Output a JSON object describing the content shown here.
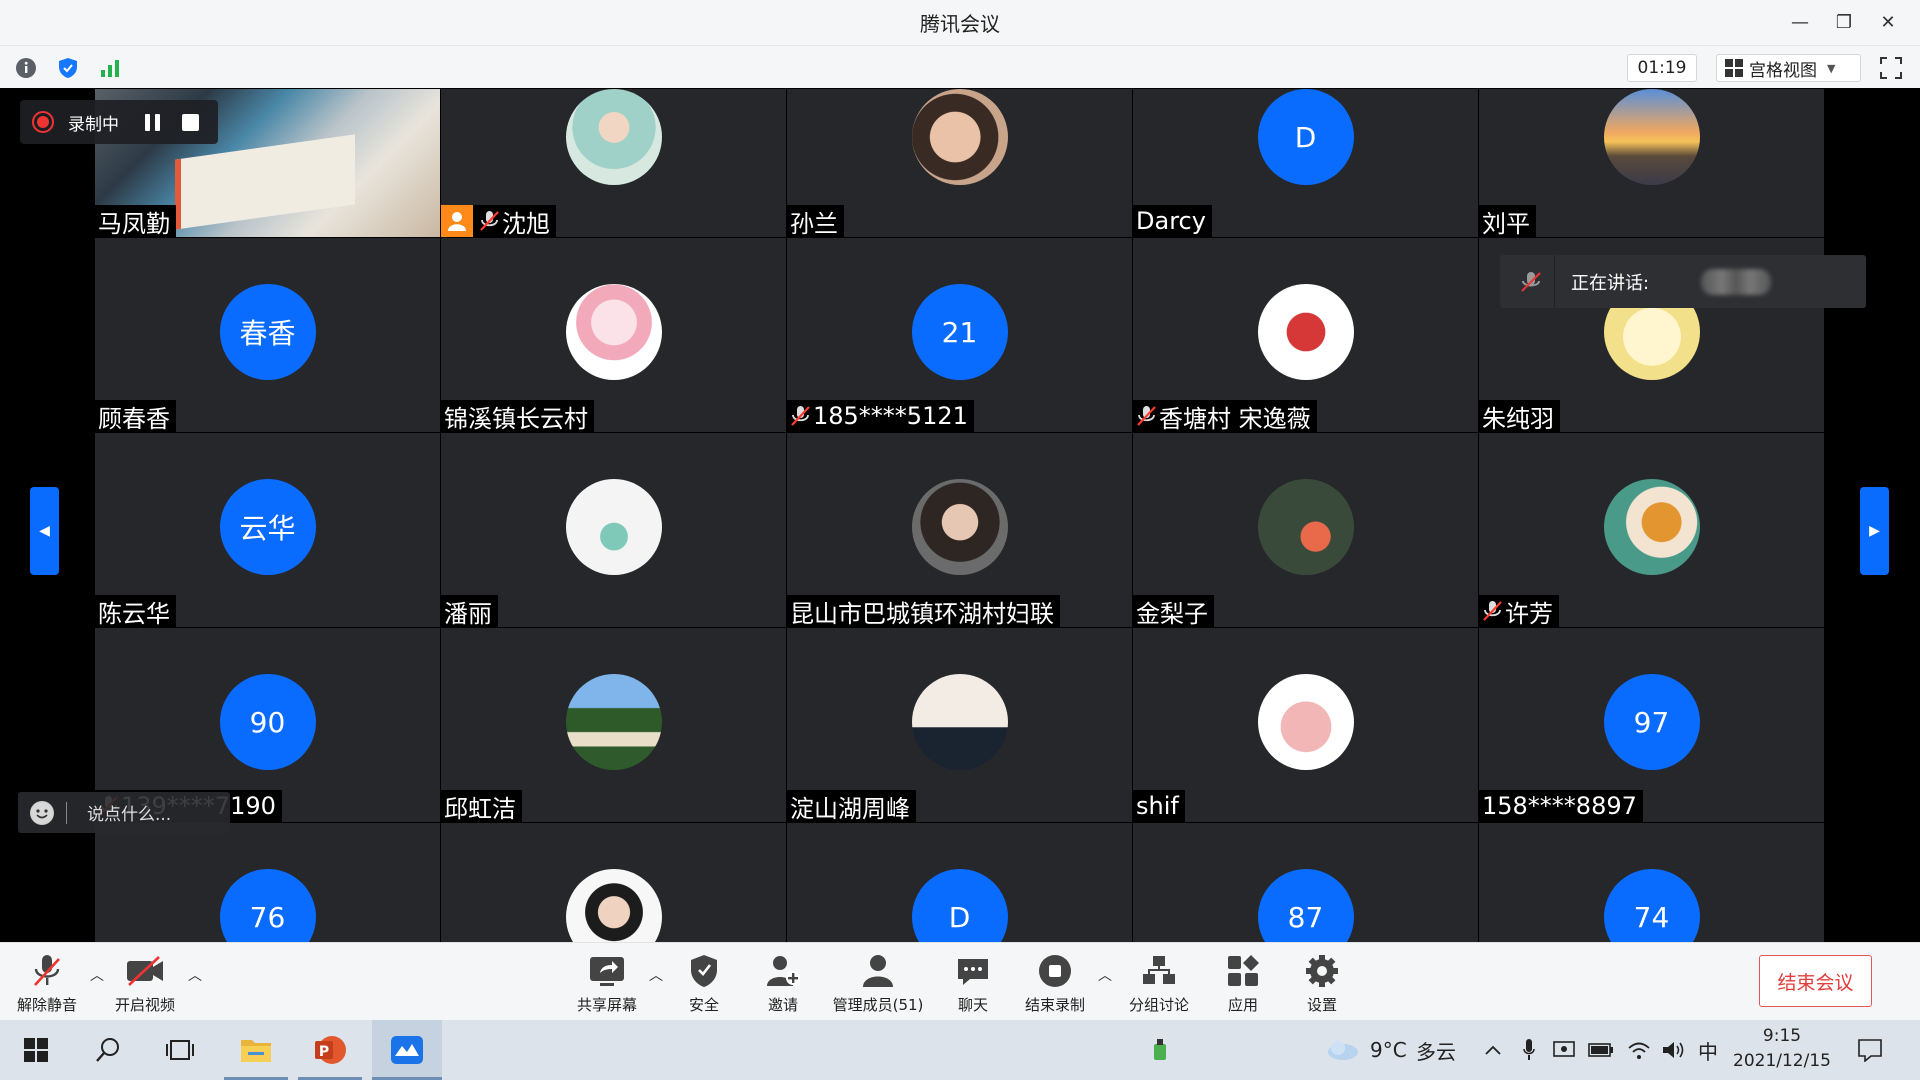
{
  "window": {
    "title": "腾讯会议",
    "minimize": "—",
    "restore": "❐",
    "close": "✕"
  },
  "toolbar": {
    "timer": "01:19",
    "view_label": "宫格视图"
  },
  "recording": {
    "label": "录制中"
  },
  "speaking": {
    "label": "正在讲话:"
  },
  "chat": {
    "placeholder": "说点什么..."
  },
  "tiles": [
    {
      "name": "马凤勤",
      "avatar": "",
      "avatar_type": "video",
      "muted": false
    },
    {
      "name": "沈旭",
      "avatar": "",
      "avatar_type": "photo-celadon",
      "muted": true,
      "host": true
    },
    {
      "name": "孙兰",
      "avatar": "",
      "avatar_type": "photo-face",
      "muted": false
    },
    {
      "name": "Darcy",
      "avatar": "D",
      "avatar_type": "letter",
      "muted": false
    },
    {
      "name": "刘平",
      "avatar": "",
      "avatar_type": "photo-sunset",
      "muted": false
    },
    {
      "name": "顾春香",
      "avatar": "春香",
      "avatar_type": "letter",
      "muted": false
    },
    {
      "name": "锦溪镇长云村",
      "avatar": "",
      "avatar_type": "photo-pink",
      "muted": false
    },
    {
      "name": "185****5121",
      "avatar": "21",
      "avatar_type": "letter",
      "muted": true
    },
    {
      "name": "香塘村 宋逸薇",
      "avatar": "",
      "avatar_type": "photo-red",
      "muted": true
    },
    {
      "name": "朱纯羽",
      "avatar": "",
      "avatar_type": "photo-duck",
      "muted": false
    },
    {
      "name": "陈云华",
      "avatar": "云华",
      "avatar_type": "letter",
      "muted": false
    },
    {
      "name": "潘丽",
      "avatar": "",
      "avatar_type": "photo-girl",
      "muted": false
    },
    {
      "name": "昆山市巴城镇环湖村妇联",
      "avatar": "",
      "avatar_type": "photo-glasses",
      "muted": false
    },
    {
      "name": "金梨子",
      "avatar": "",
      "avatar_type": "photo-flower",
      "muted": false
    },
    {
      "name": "许芳",
      "avatar": "",
      "avatar_type": "photo-bouquet",
      "muted": true
    },
    {
      "name": "139****7190",
      "avatar": "90",
      "avatar_type": "letter",
      "muted": true
    },
    {
      "name": "邱虹洁",
      "avatar": "",
      "avatar_type": "photo-house",
      "muted": false
    },
    {
      "name": "淀山湖周峰",
      "avatar": "",
      "avatar_type": "photo-person",
      "muted": false
    },
    {
      "name": "shif",
      "avatar": "",
      "avatar_type": "photo-cartoon",
      "muted": false
    },
    {
      "name": "158****8897",
      "avatar": "97",
      "avatar_type": "letter",
      "muted": false
    },
    {
      "name": "",
      "avatar": "76",
      "avatar_type": "letter",
      "muted": false
    },
    {
      "name": "",
      "avatar": "",
      "avatar_type": "photo-woman",
      "muted": false
    },
    {
      "name": "",
      "avatar": "D",
      "avatar_type": "letter",
      "muted": false
    },
    {
      "name": "",
      "avatar": "87",
      "avatar_type": "letter",
      "muted": false
    },
    {
      "name": "",
      "avatar": "74",
      "avatar_type": "letter",
      "muted": false
    }
  ],
  "controls": {
    "unmute": "解除静音",
    "start_video": "开启视频",
    "share_screen": "共享屏幕",
    "security": "安全",
    "invite": "邀请",
    "manage_members": "管理成员(51)",
    "chat": "聊天",
    "end_recording": "结束录制",
    "breakout": "分组讨论",
    "apps": "应用",
    "settings": "设置",
    "end_meeting": "结束会议"
  },
  "taskbar": {
    "weather_temp": "9°C",
    "weather_desc": "多云",
    "ime": "中",
    "time": "9:15",
    "date": "2021/12/15"
  },
  "colors": {
    "accent": "#0a6cff",
    "tile_bg": "#25272b",
    "end_red": "#e23c3c",
    "host_orange": "#ff8a1a"
  }
}
